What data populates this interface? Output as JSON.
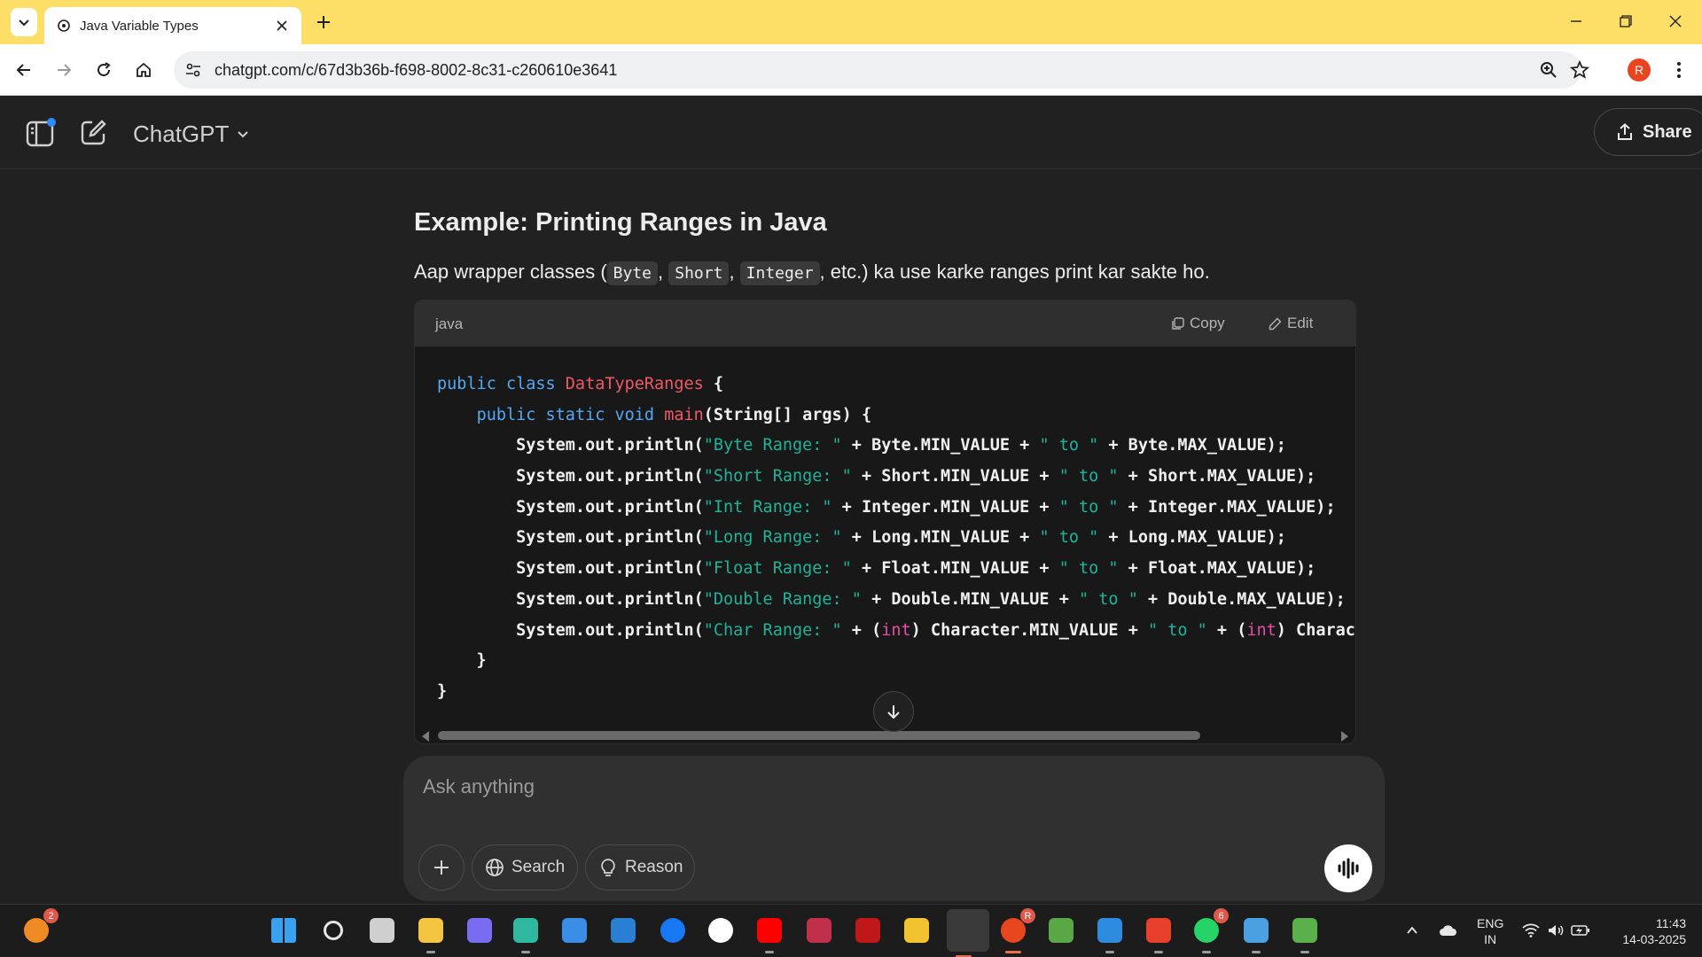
{
  "browser": {
    "tab_title": "Java Variable Types",
    "url": "chatgpt.com/c/67d3b36b-f698-8002-8c31-c260610e3641",
    "profile_initial": "R"
  },
  "app": {
    "model_name": "ChatGPT",
    "share_label": "Share"
  },
  "message": {
    "heading": "Example: Printing Ranges in Java",
    "intro_before": "Aap wrapper classes (",
    "inline_codes": [
      "Byte",
      "Short",
      "Integer"
    ],
    "intro_after": ", etc.) ka use karke ranges print kar sakte ho.",
    "code_language": "java",
    "copy_label": "Copy",
    "edit_label": "Edit",
    "code_lines": [
      [
        {
          "t": "kw",
          "v": "public class "
        },
        {
          "t": "cls",
          "v": "DataTypeRanges"
        },
        {
          "t": "p",
          "v": " {"
        }
      ],
      [
        {
          "t": "p",
          "v": "    "
        },
        {
          "t": "kw",
          "v": "public static void "
        },
        {
          "t": "cls",
          "v": "main"
        },
        {
          "t": "p",
          "v": "(String[] args) {"
        }
      ],
      [
        {
          "t": "p",
          "v": "        System.out.println("
        },
        {
          "t": "str",
          "v": "\"Byte Range: \""
        },
        {
          "t": "p",
          "v": " + Byte.MIN_VALUE + "
        },
        {
          "t": "str",
          "v": "\" to \""
        },
        {
          "t": "p",
          "v": " + Byte.MAX_VALUE);"
        }
      ],
      [
        {
          "t": "p",
          "v": "        System.out.println("
        },
        {
          "t": "str",
          "v": "\"Short Range: \""
        },
        {
          "t": "p",
          "v": " + Short.MIN_VALUE + "
        },
        {
          "t": "str",
          "v": "\" to \""
        },
        {
          "t": "p",
          "v": " + Short.MAX_VALUE);"
        }
      ],
      [
        {
          "t": "p",
          "v": "        System.out.println("
        },
        {
          "t": "str",
          "v": "\"Int Range: \""
        },
        {
          "t": "p",
          "v": " + Integer.MIN_VALUE + "
        },
        {
          "t": "str",
          "v": "\" to \""
        },
        {
          "t": "p",
          "v": " + Integer.MAX_VALUE);"
        }
      ],
      [
        {
          "t": "p",
          "v": "        System.out.println("
        },
        {
          "t": "str",
          "v": "\"Long Range: \""
        },
        {
          "t": "p",
          "v": " + Long.MIN_VALUE + "
        },
        {
          "t": "str",
          "v": "\" to \""
        },
        {
          "t": "p",
          "v": " + Long.MAX_VALUE);"
        }
      ],
      [
        {
          "t": "p",
          "v": "        System.out.println("
        },
        {
          "t": "str",
          "v": "\"Float Range: \""
        },
        {
          "t": "p",
          "v": " + Float.MIN_VALUE + "
        },
        {
          "t": "str",
          "v": "\" to \""
        },
        {
          "t": "p",
          "v": " + Float.MAX_VALUE);"
        }
      ],
      [
        {
          "t": "p",
          "v": "        System.out.println("
        },
        {
          "t": "str",
          "v": "\"Double Range: \""
        },
        {
          "t": "p",
          "v": " + Double.MIN_VALUE + "
        },
        {
          "t": "str",
          "v": "\" to \""
        },
        {
          "t": "p",
          "v": " + Double.MAX_VALUE);"
        }
      ],
      [
        {
          "t": "p",
          "v": "        System.out.println("
        },
        {
          "t": "str",
          "v": "\"Char Range: \""
        },
        {
          "t": "p",
          "v": " + ("
        },
        {
          "t": "typ",
          "v": "int"
        },
        {
          "t": "p",
          "v": ") Character.MIN_VALUE + "
        },
        {
          "t": "str",
          "v": "\" to \""
        },
        {
          "t": "p",
          "v": " + ("
        },
        {
          "t": "typ",
          "v": "int"
        },
        {
          "t": "p",
          "v": ") Charact"
        }
      ],
      [
        {
          "t": "p",
          "v": "    }"
        }
      ],
      [
        {
          "t": "p",
          "v": "}"
        }
      ]
    ]
  },
  "composer": {
    "placeholder": "Ask anything",
    "search_label": "Search",
    "reason_label": "Reason"
  },
  "taskbar": {
    "apps": [
      {
        "name": "copilot-app-icon",
        "color": "#f08a24",
        "badge": "2"
      },
      {
        "name": "start-icon",
        "color": "#3aa0f0"
      },
      {
        "name": "taskbar-search-icon",
        "color": "#e6e6e6"
      },
      {
        "name": "task-view-icon",
        "color": "#cfcfcf"
      },
      {
        "name": "file-explorer-icon",
        "color": "#f5c542"
      },
      {
        "name": "copilot-icon",
        "color": "#7a6cf0"
      },
      {
        "name": "edge-icon",
        "color": "#2fb8a0"
      },
      {
        "name": "ms-store-icon",
        "color": "#3a8ee6"
      },
      {
        "name": "mysql-icon",
        "color": "#2a7fd4"
      },
      {
        "name": "facebook-icon",
        "color": "#1877f2"
      },
      {
        "name": "whatsapp-web-icon",
        "color": "#ffffff"
      },
      {
        "name": "youtube-icon",
        "color": "#ff0000"
      },
      {
        "name": "screen-recorder-icon",
        "color": "#c0304a"
      },
      {
        "name": "mcafee-icon",
        "color": "#c01818"
      },
      {
        "name": "sticky-folder-icon",
        "color": "#f2c230"
      },
      {
        "name": "terminal-icon",
        "color": "#3a3a3a"
      },
      {
        "name": "chrome-icon",
        "color": "#e8461f",
        "badge": "R"
      },
      {
        "name": "image-viewer-icon",
        "color": "#5aa845"
      },
      {
        "name": "notepad-icon",
        "color": "#2e8ce0"
      },
      {
        "name": "wps-office-icon",
        "color": "#e8402a"
      },
      {
        "name": "whatsapp-icon",
        "color": "#25d366",
        "badge": "6"
      },
      {
        "name": "remote-desktop-icon",
        "color": "#4aa0e0"
      },
      {
        "name": "network-tool-icon",
        "color": "#5ab04a"
      }
    ],
    "language": "ENG",
    "region": "IN",
    "time": "11:43",
    "date": "14-03-2025"
  }
}
